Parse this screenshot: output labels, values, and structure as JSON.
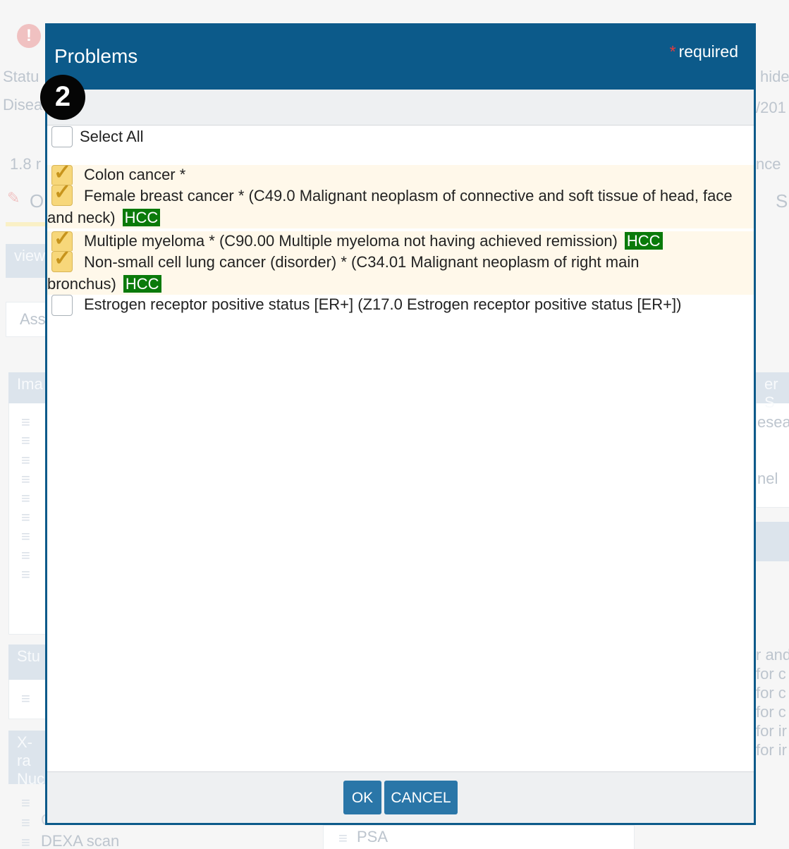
{
  "background": {
    "labels": {
      "status": "Statu",
      "disease": "Disea",
      "measure": "1.8 r",
      "o_tab": "O",
      "view": "view",
      "assess": "Ass",
      "ima": "Ima",
      "stu": "Stu",
      "xray": "X-ra",
      "nuc": "Nuc",
      "hide": "hide",
      "year": "/201",
      "nce": "nce",
      "s_tab": "S",
      "er_s": "er S",
      "esear": "esear",
      "nel": "nel",
      "and": "r and",
      "for1": "for c",
      "for2": "for c",
      "for3": "for c",
      "for4": "for ir",
      "for5": "for ir",
      "bottom_left": "DEXA scan",
      "bottom_partial": "CXR PA and lateral",
      "bottom_right": "PSA"
    }
  },
  "modal": {
    "title": "Problems",
    "required_star": "*",
    "required_label": "required",
    "step_number": "2",
    "select_all_label": "Select All",
    "problems": [
      {
        "text": "Colon cancer *",
        "checked": true,
        "hcc": ""
      },
      {
        "text": "Female breast cancer * (C49.0 Malignant neoplasm of connective and soft tissue of head, face and neck)",
        "checked": true,
        "hcc": "HCC"
      },
      {
        "text": "Multiple myeloma * (C90.00 Multiple myeloma not having achieved remission)",
        "checked": true,
        "hcc": "HCC"
      },
      {
        "text": "Non-small cell lung cancer (disorder) * (C34.01 Malignant neoplasm of right main bronchus)",
        "checked": true,
        "hcc": "HCC"
      },
      {
        "text": "Estrogen receptor positive status [ER+] (Z17.0 Estrogen receptor positive status [ER+])",
        "checked": false,
        "hcc": ""
      }
    ],
    "ok_label": "OK",
    "cancel_label": "CANCEL"
  },
  "colors": {
    "header_blue": "#0c5a8a",
    "button_blue": "#2a76a8",
    "hcc_green": "#0a7a0a",
    "check_yellow": "#f7d77a",
    "required_red": "#e83b3b"
  }
}
